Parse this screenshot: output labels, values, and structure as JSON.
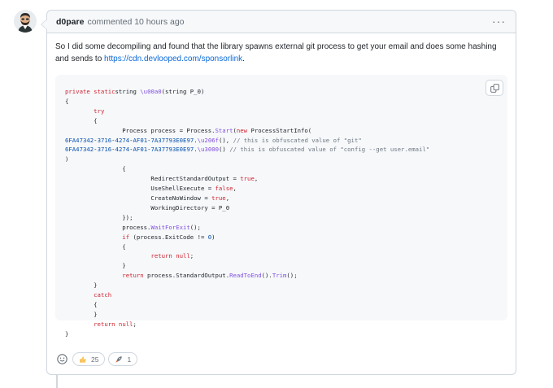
{
  "comment": {
    "author": "d0pare",
    "meta": "commented 10 hours ago",
    "more_label": "···",
    "body": {
      "text_before": "So I did some decompiling and found that the library spawns external git process to get your email and does some hashing and sends to ",
      "link_text": "https://cdn.devlooped.com/sponsorlink",
      "text_after": "."
    },
    "code_lines": [
      [
        [
          "kw",
          "private static"
        ],
        [
          "",
          "string "
        ],
        [
          "fn",
          "\\u00a0"
        ],
        [
          "",
          "(string P_0)"
        ]
      ],
      [
        [
          "",
          "{"
        ]
      ],
      [
        [
          "",
          "        "
        ],
        [
          "kw",
          "try"
        ]
      ],
      [
        [
          "",
          "        {"
        ]
      ],
      [
        [
          "",
          "                Process process = Process."
        ],
        [
          "fn",
          "Start"
        ],
        [
          "",
          "("
        ],
        [
          "kw",
          "new"
        ],
        [
          "",
          " ProcessStartInfo("
        ]
      ],
      [
        [
          "num",
          "6FA47342"
        ],
        [
          "",
          "-"
        ],
        [
          "num",
          "3716"
        ],
        [
          "",
          "-"
        ],
        [
          "num",
          "4274"
        ],
        [
          "",
          "-"
        ],
        [
          "num",
          "AF01"
        ],
        [
          "",
          "-"
        ],
        [
          "num",
          "7A37793E0E97"
        ],
        [
          "",
          "."
        ],
        [
          "fn",
          "\\u206f"
        ],
        [
          "",
          "(), "
        ],
        [
          "cm",
          "// this is obfuscated value of \"git\""
        ]
      ],
      [
        [
          "num",
          "6FA47342"
        ],
        [
          "",
          "-"
        ],
        [
          "num",
          "3716"
        ],
        [
          "",
          "-"
        ],
        [
          "num",
          "4274"
        ],
        [
          "",
          "-"
        ],
        [
          "num",
          "AF01"
        ],
        [
          "",
          "-"
        ],
        [
          "num",
          "7A37793E0E97"
        ],
        [
          "",
          "."
        ],
        [
          "fn",
          "\\u3000"
        ],
        [
          "",
          "() "
        ],
        [
          "cm",
          "// this is obfuscated value of \"config --get user.email\""
        ]
      ],
      [
        [
          "",
          ")"
        ]
      ],
      [
        [
          "",
          "                {"
        ]
      ],
      [
        [
          "",
          "                        RedirectStandardOutput = "
        ],
        [
          "kw",
          "true"
        ],
        [
          "",
          ","
        ]
      ],
      [
        [
          "",
          "                        UseShellExecute = "
        ],
        [
          "kw",
          "false"
        ],
        [
          "",
          ","
        ]
      ],
      [
        [
          "",
          "                        CreateNoWindow = "
        ],
        [
          "kw",
          "true"
        ],
        [
          "",
          ","
        ]
      ],
      [
        [
          "",
          "                        WorkingDirectory = P_0"
        ]
      ],
      [
        [
          "",
          "                });"
        ]
      ],
      [
        [
          "",
          "                process."
        ],
        [
          "fn",
          "WaitForExit"
        ],
        [
          "",
          "();"
        ]
      ],
      [
        [
          "",
          "                "
        ],
        [
          "kw",
          "if"
        ],
        [
          "",
          " (process.ExitCode != "
        ],
        [
          "num",
          "0"
        ],
        [
          "",
          ")"
        ]
      ],
      [
        [
          "",
          "                {"
        ]
      ],
      [
        [
          "",
          "                        "
        ],
        [
          "kw",
          "return"
        ],
        [
          "",
          " "
        ],
        [
          "kw",
          "null"
        ],
        [
          "",
          ";"
        ]
      ],
      [
        [
          "",
          "                }"
        ]
      ],
      [
        [
          "",
          "                "
        ],
        [
          "kw",
          "return"
        ],
        [
          "",
          " process.StandardOutput."
        ],
        [
          "fn",
          "ReadToEnd"
        ],
        [
          "",
          "()."
        ],
        [
          "fn",
          "Trim"
        ],
        [
          "",
          "();"
        ]
      ],
      [
        [
          "",
          "        }"
        ]
      ],
      [
        [
          "",
          "        "
        ],
        [
          "kw",
          "catch"
        ]
      ],
      [
        [
          "",
          "        {"
        ]
      ],
      [
        [
          "",
          "        }"
        ]
      ],
      [
        [
          "",
          "        "
        ],
        [
          "kw",
          "return"
        ],
        [
          "",
          " "
        ],
        [
          "kw",
          "null"
        ],
        [
          "",
          ";"
        ]
      ],
      [
        [
          "",
          "}"
        ]
      ]
    ],
    "reactions": [
      {
        "icon": "thumbs-up-icon",
        "count": "25"
      },
      {
        "icon": "rocket-icon",
        "count": "1"
      }
    ]
  }
}
